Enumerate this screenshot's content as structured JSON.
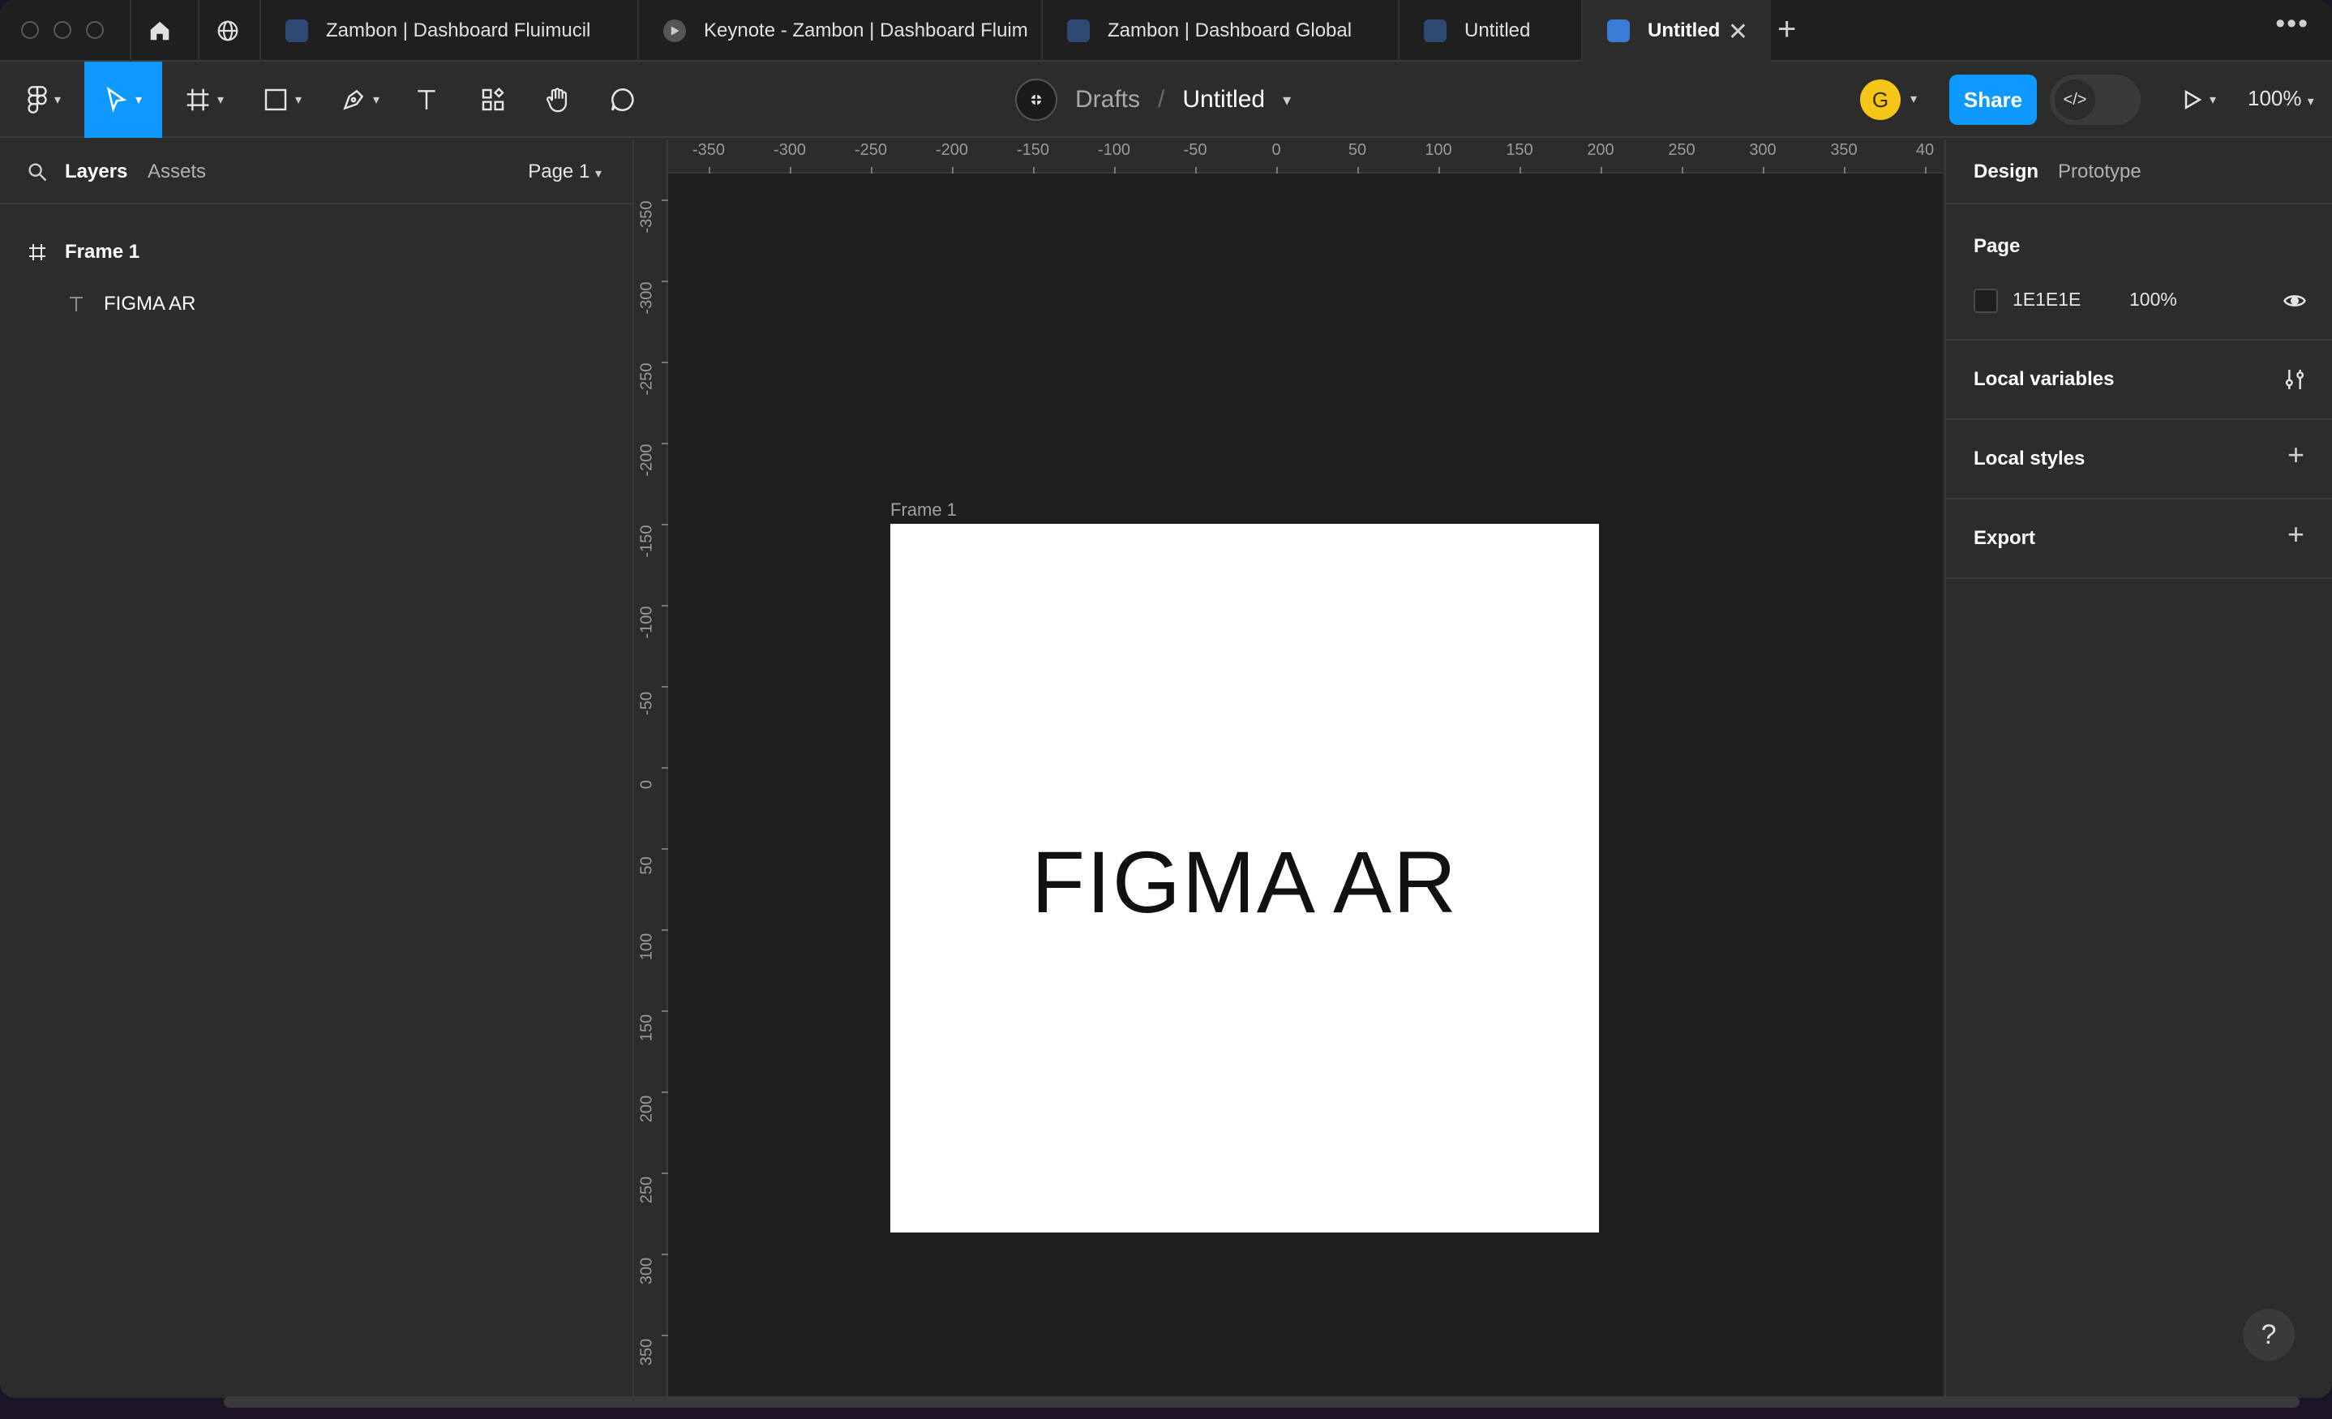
{
  "tabs": [
    {
      "label": "Zambon | Dashboard Fluimucil",
      "icon": "figma-file-icon"
    },
    {
      "label": "Keynote - Zambon | Dashboard Fluim",
      "icon": "play-icon"
    },
    {
      "label": "Zambon | Dashboard Global",
      "icon": "figma-file-icon"
    },
    {
      "label": "Untitled",
      "icon": "figma-file-icon"
    },
    {
      "label": "Untitled",
      "icon": "figma-file-icon",
      "active": true
    }
  ],
  "breadcrumb": {
    "team": "Drafts",
    "separator": "/",
    "file": "Untitled"
  },
  "user_initial": "G",
  "share_label": "Share",
  "zoom_label": "100%",
  "left_panel": {
    "tabs": {
      "layers": "Layers",
      "assets": "Assets"
    },
    "page_selector": "Page 1",
    "layers": [
      {
        "name": "Frame 1",
        "type": "frame"
      },
      {
        "name": "FIGMA AR",
        "type": "text"
      }
    ]
  },
  "canvas": {
    "frame_label": "Frame 1",
    "frame_text": "FIGMA AR",
    "ruler_h": [
      "-350",
      "-300",
      "-250",
      "-200",
      "-150",
      "-100",
      "-50",
      "0",
      "50",
      "100",
      "150",
      "200",
      "250",
      "300",
      "350",
      "40"
    ],
    "ruler_v": [
      "-350",
      "-300",
      "-250",
      "-200",
      "-150",
      "-100",
      "-50",
      "0",
      "50",
      "100",
      "150",
      "200",
      "250",
      "300",
      "350"
    ]
  },
  "right_panel": {
    "tabs": {
      "design": "Design",
      "prototype": "Prototype"
    },
    "page_section": {
      "title": "Page",
      "color_hex": "1E1E1E",
      "opacity": "100%"
    },
    "sections": [
      "Local variables",
      "Local styles",
      "Export"
    ]
  },
  "help_label": "?",
  "colors": {
    "accent": "#0d99ff",
    "canvas": "#1e1e1e",
    "panel": "#2c2c2c",
    "avatar": "#f5c518"
  }
}
